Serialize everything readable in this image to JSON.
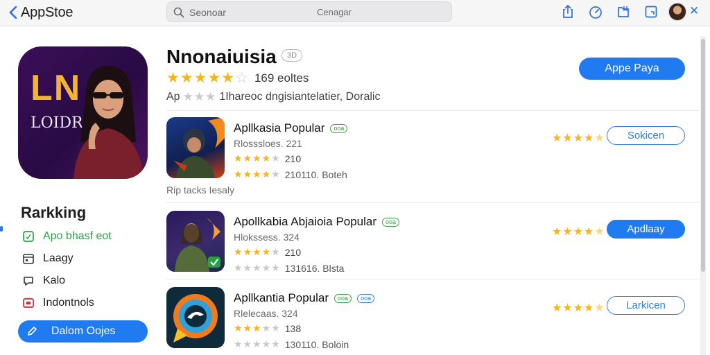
{
  "window": {
    "back_label": "AppStoe",
    "search_placeholder": "Seonoar",
    "search_center_text": "Cenagar"
  },
  "toolbar_icons": [
    "share-icon",
    "speed-icon",
    "bookmark-icon",
    "window-icon",
    "profile-avatar",
    "close-icon"
  ],
  "sidebar": {
    "hero_logo_text": "LN",
    "hero_sub_text": "LOIDRO",
    "section_title": "Rarkking",
    "items": [
      {
        "label": "Apo bhasf eot",
        "icon": "device-icon",
        "active": true
      },
      {
        "label": "Laagy",
        "icon": "calendar-icon",
        "active": false
      },
      {
        "label": "Kalo",
        "icon": "chat-icon",
        "active": false
      },
      {
        "label": "Indontnols",
        "icon": "video-icon",
        "active": false
      }
    ],
    "action_label": "Dalom Oojes"
  },
  "header": {
    "title": "Nnonaiuisia",
    "age_badge": "3D",
    "rating_stars": 5,
    "rating_count": "169 eoltes",
    "category_prefix": "Ap",
    "category_line": "1Ihareoc dngisiantelatier, Doralic",
    "primary_button": "Appe Paya"
  },
  "between_text": "Rip tacks Iesaly",
  "apps": [
    {
      "name": "Apllkasia Popular",
      "badges": [
        "ooa"
      ],
      "subtitle": "Rlosssloes. 221",
      "line2": "210",
      "line2_stars": 4,
      "line3": "210110. Boteh",
      "line3_stars": 4,
      "right_stars": 4.5,
      "button": "Sokicen",
      "button_style": "outline",
      "icon": "warrior-app-icon"
    },
    {
      "name": "Apollkabia Abjaioia Popular",
      "badges": [
        "ooa"
      ],
      "subtitle": "Hlokssess. 324",
      "line2": "210",
      "line2_stars": 4,
      "line3": "131616. Blsta",
      "line3_stars": 0,
      "right_stars": 4.5,
      "button": "Apdlaay",
      "button_style": "solid",
      "icon": "fantasy-app-icon"
    },
    {
      "name": "Apllkantia Popular",
      "badges": [
        "ooa",
        "ooa"
      ],
      "subtitle": "Rlelecaas. 324",
      "line2": "138",
      "line2_stars": 3,
      "line3": "130110. Boloin",
      "line3_stars": 0,
      "right_stars": 4.5,
      "button": "Larkicen",
      "button_style": "outline",
      "icon": "chat-bubble-app-icon"
    }
  ],
  "colors": {
    "accent": "#1f7bef",
    "star": "#f5b51b",
    "active_green": "#2aa043"
  }
}
